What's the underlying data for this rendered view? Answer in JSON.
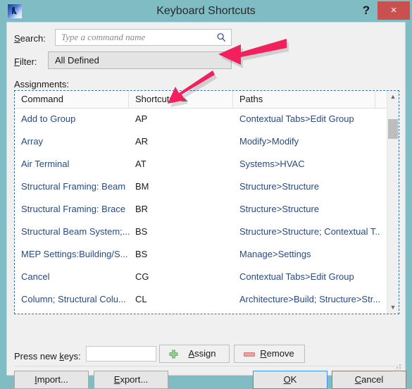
{
  "window": {
    "title": "Keyboard Shortcuts",
    "app_icon": "revit-app-icon",
    "help_label": "?",
    "close_label": "×",
    "titlebar_color": "#7fbcc3",
    "close_color": "#c9504f"
  },
  "search": {
    "label": "Search:",
    "label_accel": "S",
    "placeholder": "Type a command name",
    "value": "",
    "icon": "search-icon"
  },
  "filter": {
    "label": "Filter:",
    "label_accel": "F",
    "value": "All Defined",
    "options": [
      "All Defined"
    ]
  },
  "assignments": {
    "label": "Assignments:",
    "columns": [
      "Command",
      "Shortcuts",
      "Paths",
      ""
    ],
    "sort_column": "Shortcuts",
    "sort_direction": "ascending",
    "rows": [
      {
        "command": "Add to Group",
        "shortcut": "AP",
        "path": "Contextual Tabs>Edit Group"
      },
      {
        "command": "Array",
        "shortcut": "AR",
        "path": "Modify>Modify"
      },
      {
        "command": "Air Terminal",
        "shortcut": "AT",
        "path": "Systems>HVAC"
      },
      {
        "command": "Structural Framing: Beam",
        "shortcut": "BM",
        "path": "Structure>Structure"
      },
      {
        "command": "Structural Framing: Brace",
        "shortcut": "BR",
        "path": "Structure>Structure"
      },
      {
        "command": "Structural Beam System;...",
        "shortcut": "BS",
        "path": "Structure>Structure; Contextual T..."
      },
      {
        "command": "MEP Settings:Building/S...",
        "shortcut": "BS",
        "path": "Manage>Settings"
      },
      {
        "command": "Cancel",
        "shortcut": "CG",
        "path": "Contextual Tabs>Edit Group"
      },
      {
        "command": "Column; Structural Colu...",
        "shortcut": "CL",
        "path": "Architecture>Build; Structure>Str..."
      }
    ],
    "scroll_up_icon": "chevron-up-icon",
    "scroll_down_icon": "chevron-down-icon"
  },
  "new_keys": {
    "label": "Press new keys:",
    "label_accel": "k",
    "value": ""
  },
  "actions": {
    "assign": {
      "label": "Assign",
      "accel": "A",
      "icon": "plus-icon",
      "icon_color": "#8cc98c"
    },
    "remove": {
      "label": "Remove",
      "accel": "R",
      "icon": "minus-icon",
      "icon_color": "#f0a0a0"
    },
    "import": {
      "label": "Import...",
      "accel": "I"
    },
    "export": {
      "label": "Export...",
      "accel": "E"
    },
    "ok": {
      "label": "OK",
      "accel": "O"
    },
    "cancel": {
      "label": "Cancel",
      "accel": "C"
    }
  },
  "annotations": [
    {
      "name": "arrow-pointing-to-filter",
      "color": "#f2215e",
      "direction": "left"
    },
    {
      "name": "arrow-pointing-to-shortcuts-header",
      "color": "#f2215e",
      "direction": "down-left"
    }
  ]
}
